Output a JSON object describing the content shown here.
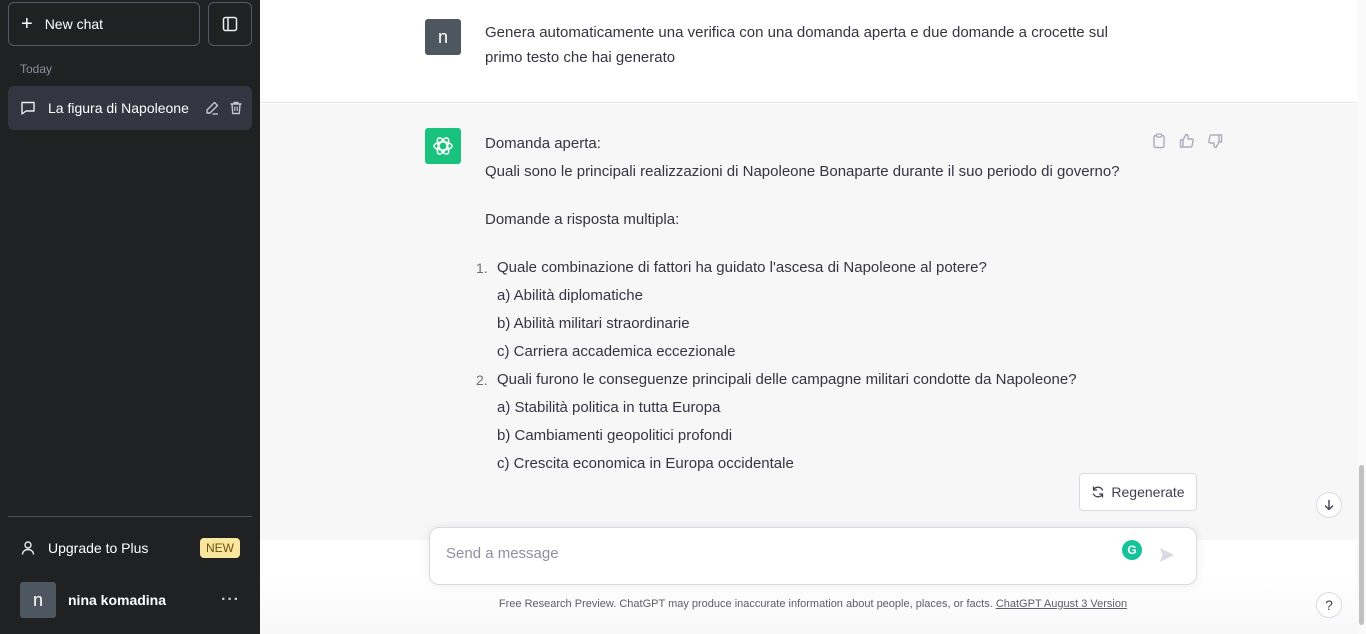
{
  "sidebar": {
    "new_chat_label": "New chat",
    "section_label": "Today",
    "active_chat_title": "La figura di Napoleone",
    "upgrade_label": "Upgrade to Plus",
    "upgrade_badge": "NEW",
    "user_initial": "n",
    "user_name": "nina komadina",
    "more_label": "···"
  },
  "conversation": {
    "user_initial": "n",
    "user_message": "Genera automaticamente una verifica con una domanda aperta e due domande a crocette sul primo testo che hai generato",
    "assistant": {
      "open_heading": "Domanda aperta:",
      "open_question": "Quali sono le principali realizzazioni di Napoleone Bonaparte durante il suo periodo di governo?",
      "mc_heading": "Domande a risposta multipla:",
      "questions": [
        {
          "num": "1.",
          "text": "Quale combinazione di fattori ha guidato l'ascesa di Napoleone al potere?",
          "options": [
            "a) Abilità diplomatiche",
            "b) Abilità militari straordinarie",
            "c) Carriera accademica eccezionale"
          ]
        },
        {
          "num": "2.",
          "text": "Quali furono le conseguenze principali delle campagne militari condotte da Napoleone?",
          "options": [
            "a) Stabilità politica in tutta Europa",
            "b) Cambiamenti geopolitici profondi",
            "c) Crescita economica in Europa occidentale"
          ]
        }
      ]
    }
  },
  "composer": {
    "regenerate_label": "Regenerate",
    "placeholder": "Send a message",
    "grammarly_letter": "G"
  },
  "footer": {
    "text": "Free Research Preview. ChatGPT may produce inaccurate information about people, places, or facts. ",
    "link_text": "ChatGPT August 3 Version",
    "help_label": "?"
  },
  "colors": {
    "sidebar_bg": "#202123",
    "assistant_avatar": "#19c37d",
    "badge_bg": "#fae69e"
  }
}
